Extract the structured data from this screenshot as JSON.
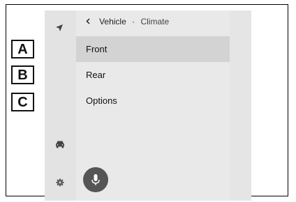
{
  "breadcrumb": {
    "back_icon": "chevron-left-icon",
    "parent": "Vehicle",
    "separator": "·",
    "current": "Climate"
  },
  "menu": {
    "items": [
      {
        "label": "Front",
        "selected": true
      },
      {
        "label": "Rear",
        "selected": false
      },
      {
        "label": "Options",
        "selected": false
      }
    ]
  },
  "callouts": [
    "A",
    "B",
    "C"
  ],
  "sidebar": {
    "icons": [
      "navigation-arrow-icon",
      "car-icon",
      "settings-gear-icon"
    ]
  },
  "voice_button_icon": "microphone-icon",
  "colors": {
    "screen_bg": "#e3e3e3",
    "panel_bg": "#e9e9e9",
    "selected_row": "#d3d3d3",
    "mic_button": "#555555"
  }
}
